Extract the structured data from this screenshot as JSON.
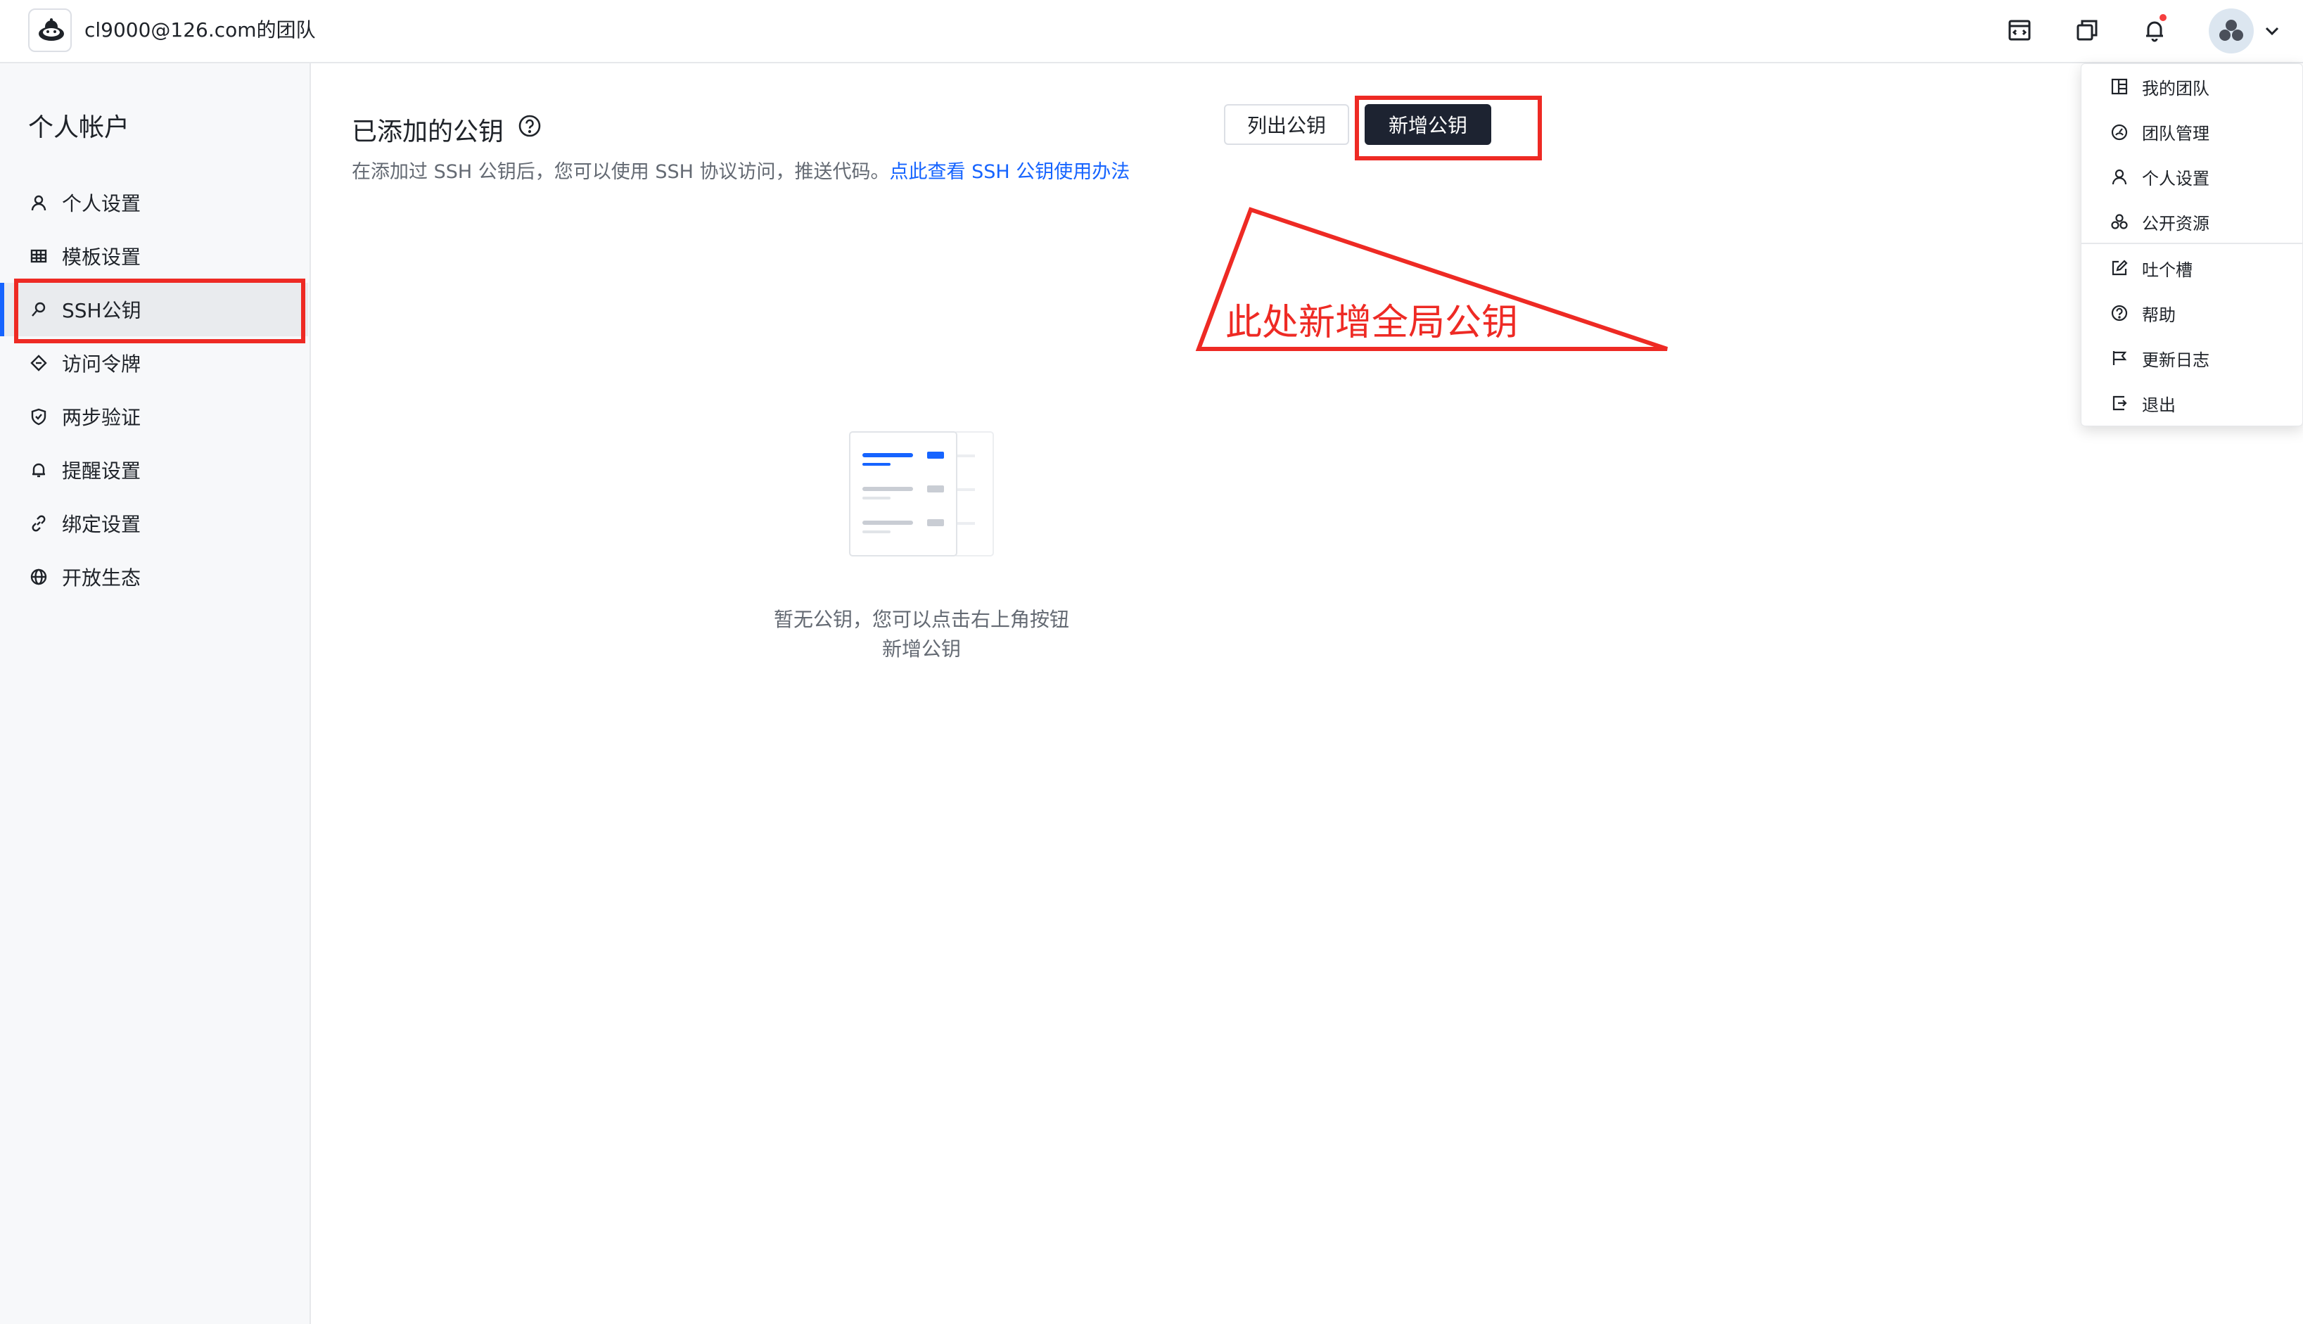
{
  "header": {
    "team_name": "cl9000@126.com的团队",
    "icons": [
      "layout-icon",
      "copy-window-icon",
      "bell-icon",
      "avatar",
      "chevron-down-icon"
    ],
    "has_notification": true
  },
  "sidebar": {
    "title": "个人帐户",
    "items": [
      {
        "label": "个人设置",
        "icon": "user-icon"
      },
      {
        "label": "模板设置",
        "icon": "grid-icon"
      },
      {
        "label": "SSH公钥",
        "icon": "key-icon",
        "active": true
      },
      {
        "label": "访问令牌",
        "icon": "ticket-icon"
      },
      {
        "label": "两步验证",
        "icon": "shield-icon"
      },
      {
        "label": "提醒设置",
        "icon": "bell-icon"
      },
      {
        "label": "绑定设置",
        "icon": "link-icon"
      },
      {
        "label": "开放生态",
        "icon": "globe-icon"
      }
    ]
  },
  "main": {
    "title": "已添加的公钥",
    "description": "在添加过 SSH 公钥后，您可以使用 SSH 协议访问，推送代码。",
    "description_link": "点此查看 SSH 公钥使用办法",
    "list_button": "列出公钥",
    "add_button": "新增公钥",
    "empty_line1": "暂无公钥，您可以点击右上角按钮",
    "empty_line2": "新增公钥"
  },
  "annotation": {
    "callout_text": "此处新增全局公钥",
    "color": "#ee2a24"
  },
  "dropdown": {
    "items": [
      {
        "label": "我的团队",
        "icon": "team-icon"
      },
      {
        "label": "团队管理",
        "icon": "dashboard-icon"
      },
      {
        "label": "个人设置",
        "icon": "user-icon",
        "highlighted": true
      },
      {
        "label": "公开资源",
        "icon": "cluster-icon"
      },
      {
        "label": "吐个槽",
        "icon": "edit-icon"
      },
      {
        "label": "帮助",
        "icon": "help-icon"
      },
      {
        "label": "更新日志",
        "icon": "flag-icon"
      },
      {
        "label": "退出",
        "icon": "logout-icon"
      }
    ]
  },
  "colors": {
    "accent": "#1664ff",
    "primary_button": "#1d2331",
    "annotation": "#ee2a24",
    "sidebar_bg": "#f7f8fa"
  }
}
